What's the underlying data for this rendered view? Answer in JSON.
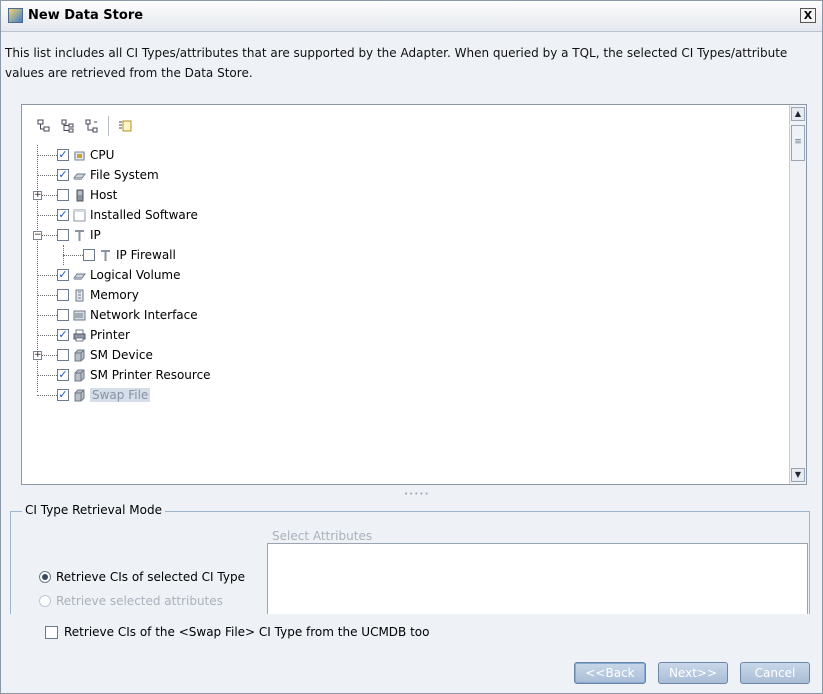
{
  "window": {
    "title": "New Data Store",
    "close_label": "X"
  },
  "description": "This list includes all CI Types/attributes that are supported by the Adapter. When queried by a TQL, the selected CI Types/attribute values are retrieved from the Data Store.",
  "toolbar": {
    "icons": [
      "tree-icon",
      "expand-all-icon",
      "collapse-all-icon",
      "properties-icon"
    ]
  },
  "tree": {
    "items": [
      {
        "label": "CPU",
        "checked": true,
        "icon": "cpu-icon"
      },
      {
        "label": "File System",
        "checked": true,
        "icon": "file-system-icon"
      },
      {
        "label": "Host",
        "checked": false,
        "icon": "host-icon",
        "expandable": true
      },
      {
        "label": "Installed Software",
        "checked": true,
        "icon": "installed-software-icon"
      },
      {
        "label": "IP",
        "checked": false,
        "icon": "ip-icon",
        "expanded": true
      },
      {
        "label": "IP Firewall",
        "checked": false,
        "icon": "ip-firewall-icon",
        "child": true
      },
      {
        "label": "Logical Volume",
        "checked": true,
        "icon": "logical-volume-icon"
      },
      {
        "label": "Memory",
        "checked": false,
        "icon": "memory-icon"
      },
      {
        "label": "Network Interface",
        "checked": false,
        "icon": "network-interface-icon"
      },
      {
        "label": "Printer",
        "checked": true,
        "icon": "printer-icon"
      },
      {
        "label": "SM Device",
        "checked": false,
        "icon": "sm-device-icon",
        "expandable": true
      },
      {
        "label": "SM Printer Resource",
        "checked": true,
        "icon": "sm-printer-resource-icon"
      },
      {
        "label": "Swap File",
        "checked": true,
        "icon": "swap-file-icon",
        "selected": true
      }
    ]
  },
  "retrieval": {
    "group_title": "CI Type Retrieval Mode",
    "attributes_label": "Select Attributes",
    "option_selected_type": "Retrieve CIs of selected CI Type",
    "option_selected_attributes": "Retrieve selected attributes",
    "selected_option": "Retrieve CIs of selected CI Type"
  },
  "ucmdb_checkbox": {
    "label": "Retrieve CIs of the <Swap File> CI Type from the UCMDB too",
    "checked": false
  },
  "buttons": {
    "back": "<<Back",
    "next": "Next>>",
    "cancel": "Cancel"
  },
  "colors": {
    "accent": "#1a58c4",
    "button": "#a9bdd6",
    "selection": "#d5dee9"
  }
}
